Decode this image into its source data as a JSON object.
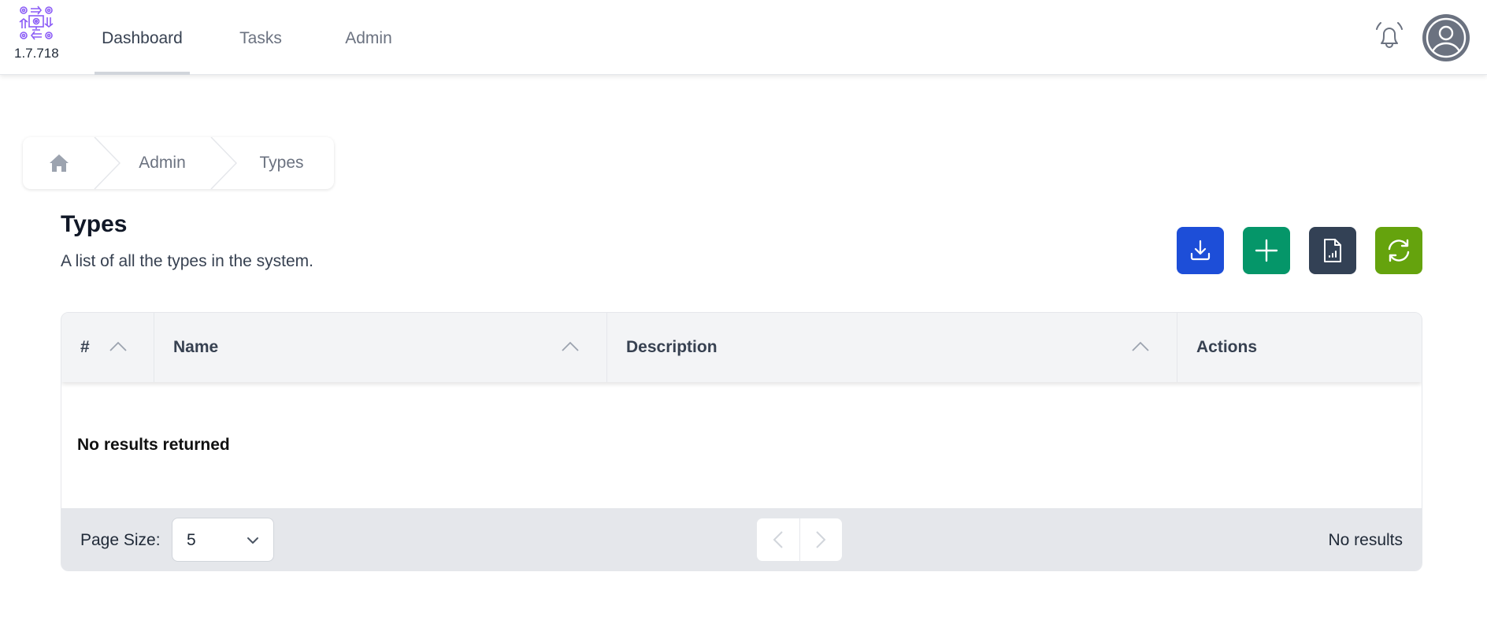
{
  "app": {
    "version": "1.7.718",
    "logo_icon": "workflow-gears-icon",
    "accent_color": "#8b5cf6"
  },
  "nav": {
    "items": [
      {
        "label": "Dashboard",
        "active": true
      },
      {
        "label": "Tasks",
        "active": false
      },
      {
        "label": "Admin",
        "active": false
      }
    ],
    "notification_icon": "bell-icon",
    "avatar_icon": "user-circle-icon"
  },
  "breadcrumb": {
    "home_icon": "home-icon",
    "items": [
      "Admin",
      "Types"
    ]
  },
  "page": {
    "title": "Types",
    "subtitle": "A list of all the types in the system."
  },
  "actions": [
    {
      "name": "download",
      "icon": "download-icon",
      "color": "#1d4ed8"
    },
    {
      "name": "add",
      "icon": "plus-icon",
      "color": "#059669"
    },
    {
      "name": "report",
      "icon": "report-file-icon",
      "color": "#334155"
    },
    {
      "name": "refresh",
      "icon": "refresh-icon",
      "color": "#65a30d"
    }
  ],
  "table": {
    "columns": [
      {
        "label": "#",
        "sortable": true
      },
      {
        "label": "Name",
        "sortable": true
      },
      {
        "label": "Description",
        "sortable": true
      },
      {
        "label": "Actions",
        "sortable": false
      }
    ],
    "rows": [],
    "empty_message": "No results returned"
  },
  "footer": {
    "page_size_label": "Page Size:",
    "page_size_value": "5",
    "results_text": "No results"
  }
}
